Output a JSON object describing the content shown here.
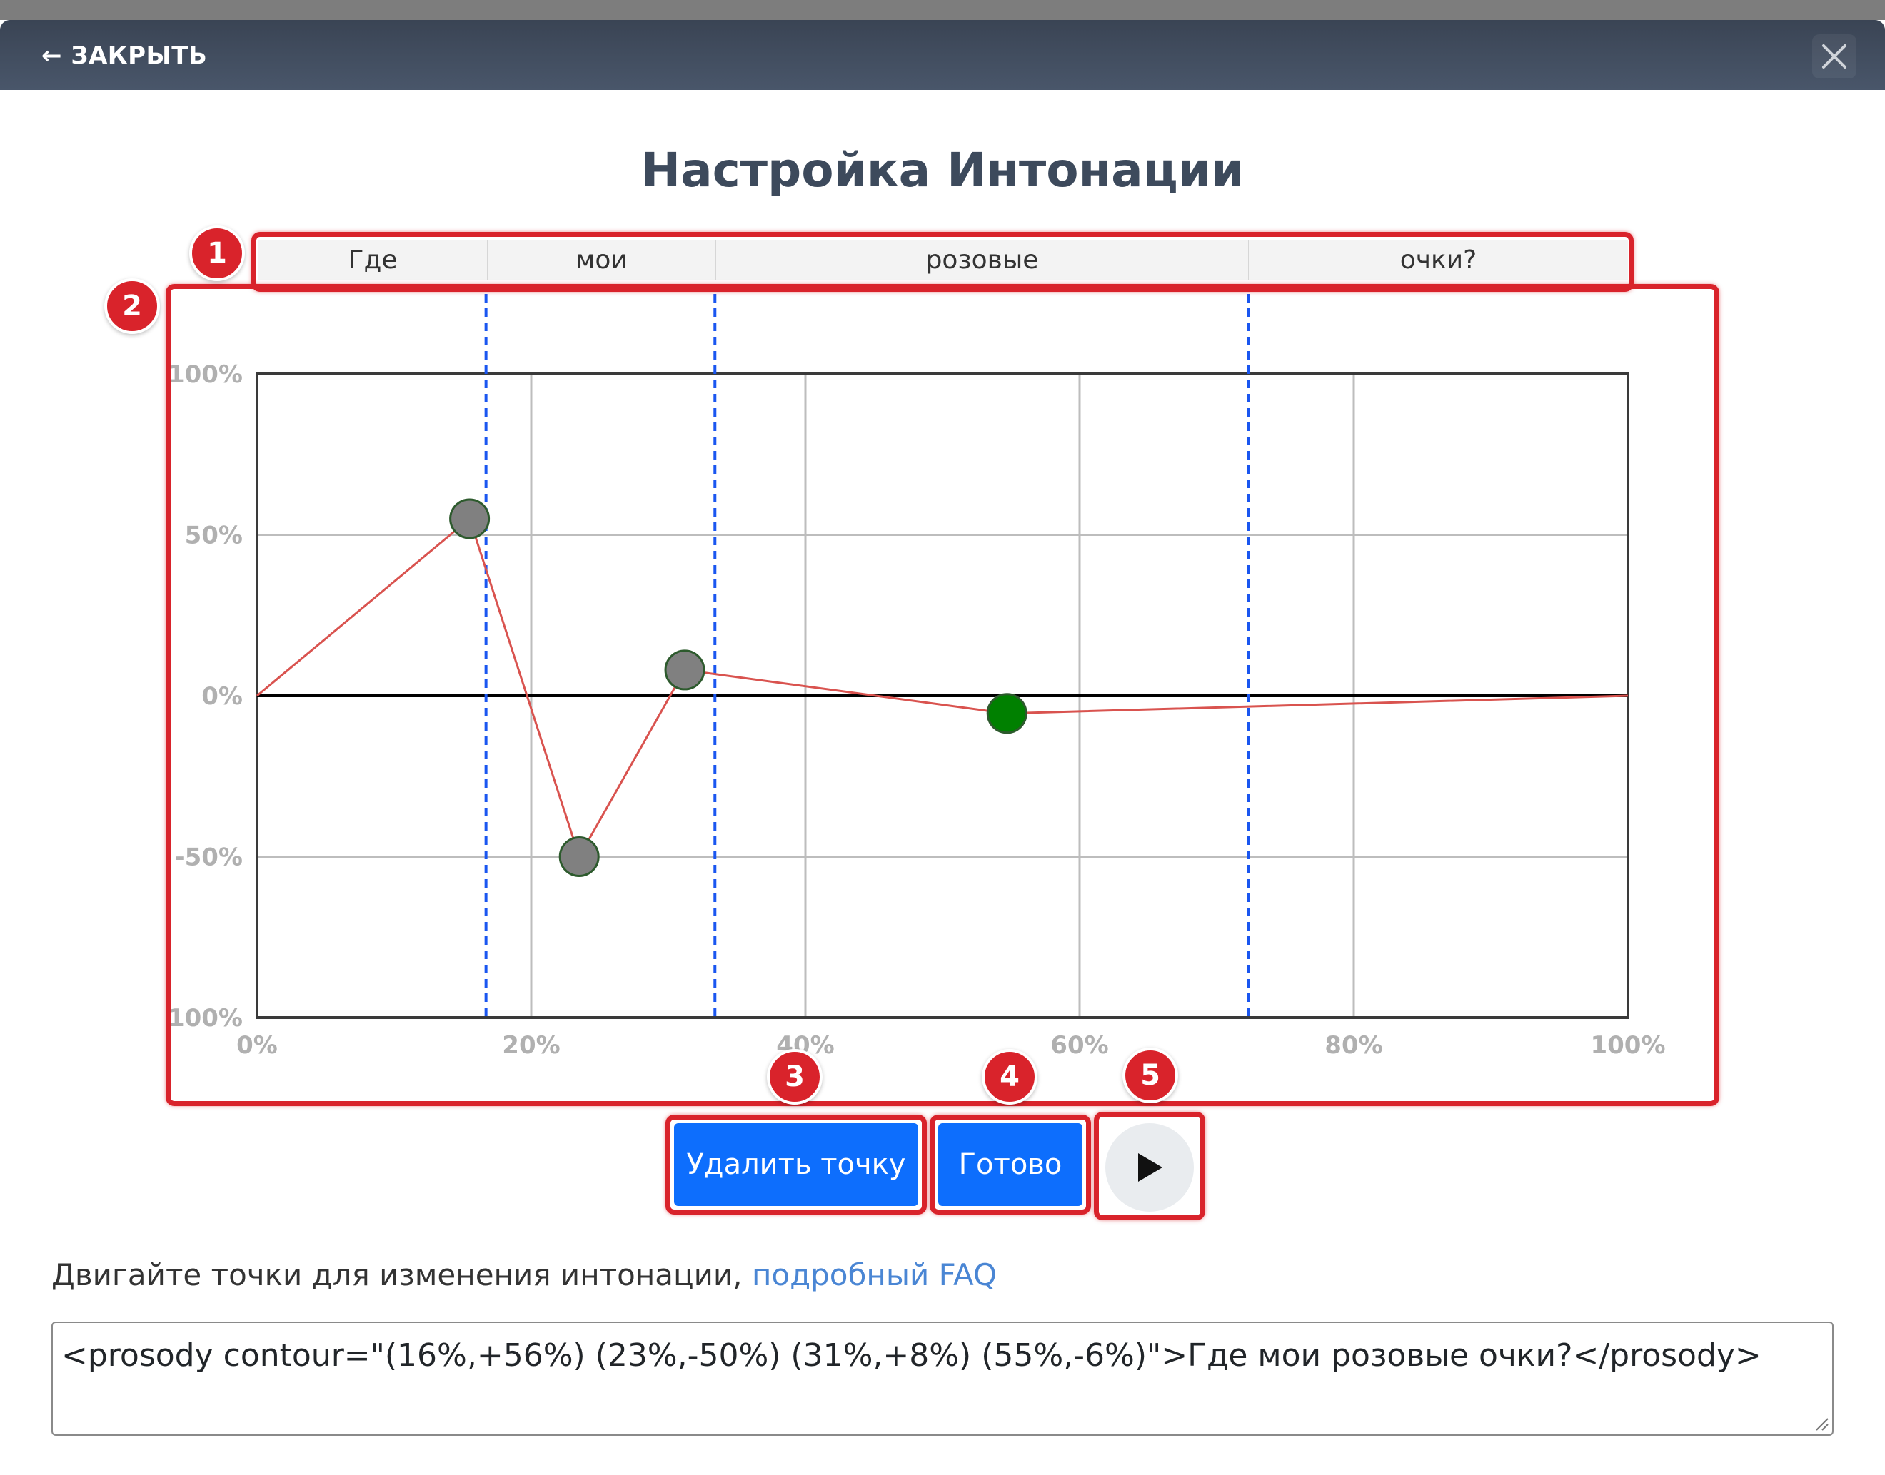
{
  "header": {
    "back_label": "← ЗАКРЫТЬ"
  },
  "title": "Настройка Интонации",
  "words": [
    "Где",
    "мои",
    "розовые",
    "очки?"
  ],
  "annotations": [
    "1",
    "2",
    "3",
    "4",
    "5"
  ],
  "chart_data": {
    "type": "line",
    "x_ticks": [
      "0%",
      "20%",
      "40%",
      "60%",
      "80%",
      "100%"
    ],
    "y_ticks": [
      "100%",
      "50%",
      "0%",
      "-50%",
      "-100%"
    ],
    "xlim": [
      0,
      100
    ],
    "ylim": [
      -100,
      100
    ],
    "grid": true,
    "word_boundaries": [
      16.7,
      33.4,
      72.3
    ],
    "points": [
      {
        "x": 0,
        "y": 0,
        "handle": false
      },
      {
        "x": 15.5,
        "y": 55,
        "handle": true,
        "selected": false
      },
      {
        "x": 23.5,
        "y": -50,
        "handle": true,
        "selected": false
      },
      {
        "x": 31.2,
        "y": 8,
        "handle": true,
        "selected": false
      },
      {
        "x": 54.7,
        "y": -5.5,
        "handle": true,
        "selected": true
      },
      {
        "x": 100,
        "y": 0,
        "handle": false
      }
    ],
    "colors": {
      "line": "#d9534f",
      "handle": "#808080",
      "selected": "#008000",
      "boundary": "#1a56f0"
    }
  },
  "buttons": {
    "delete_point": "Удалить точку",
    "done": "Готово",
    "play_icon": "play-icon"
  },
  "hint": {
    "text": "Двигайте точки для изменения интонации, ",
    "link": "подробный FAQ"
  },
  "ssml_value": "<prosody contour=\"(16%,+56%) (23%,-50%) (31%,+8%) (55%,-6%)\">Где мои розовые очки?</prosody>",
  "colors": {
    "accent": "#0d6efd",
    "annotation": "#d9232b",
    "header": "#3f4a5c"
  }
}
